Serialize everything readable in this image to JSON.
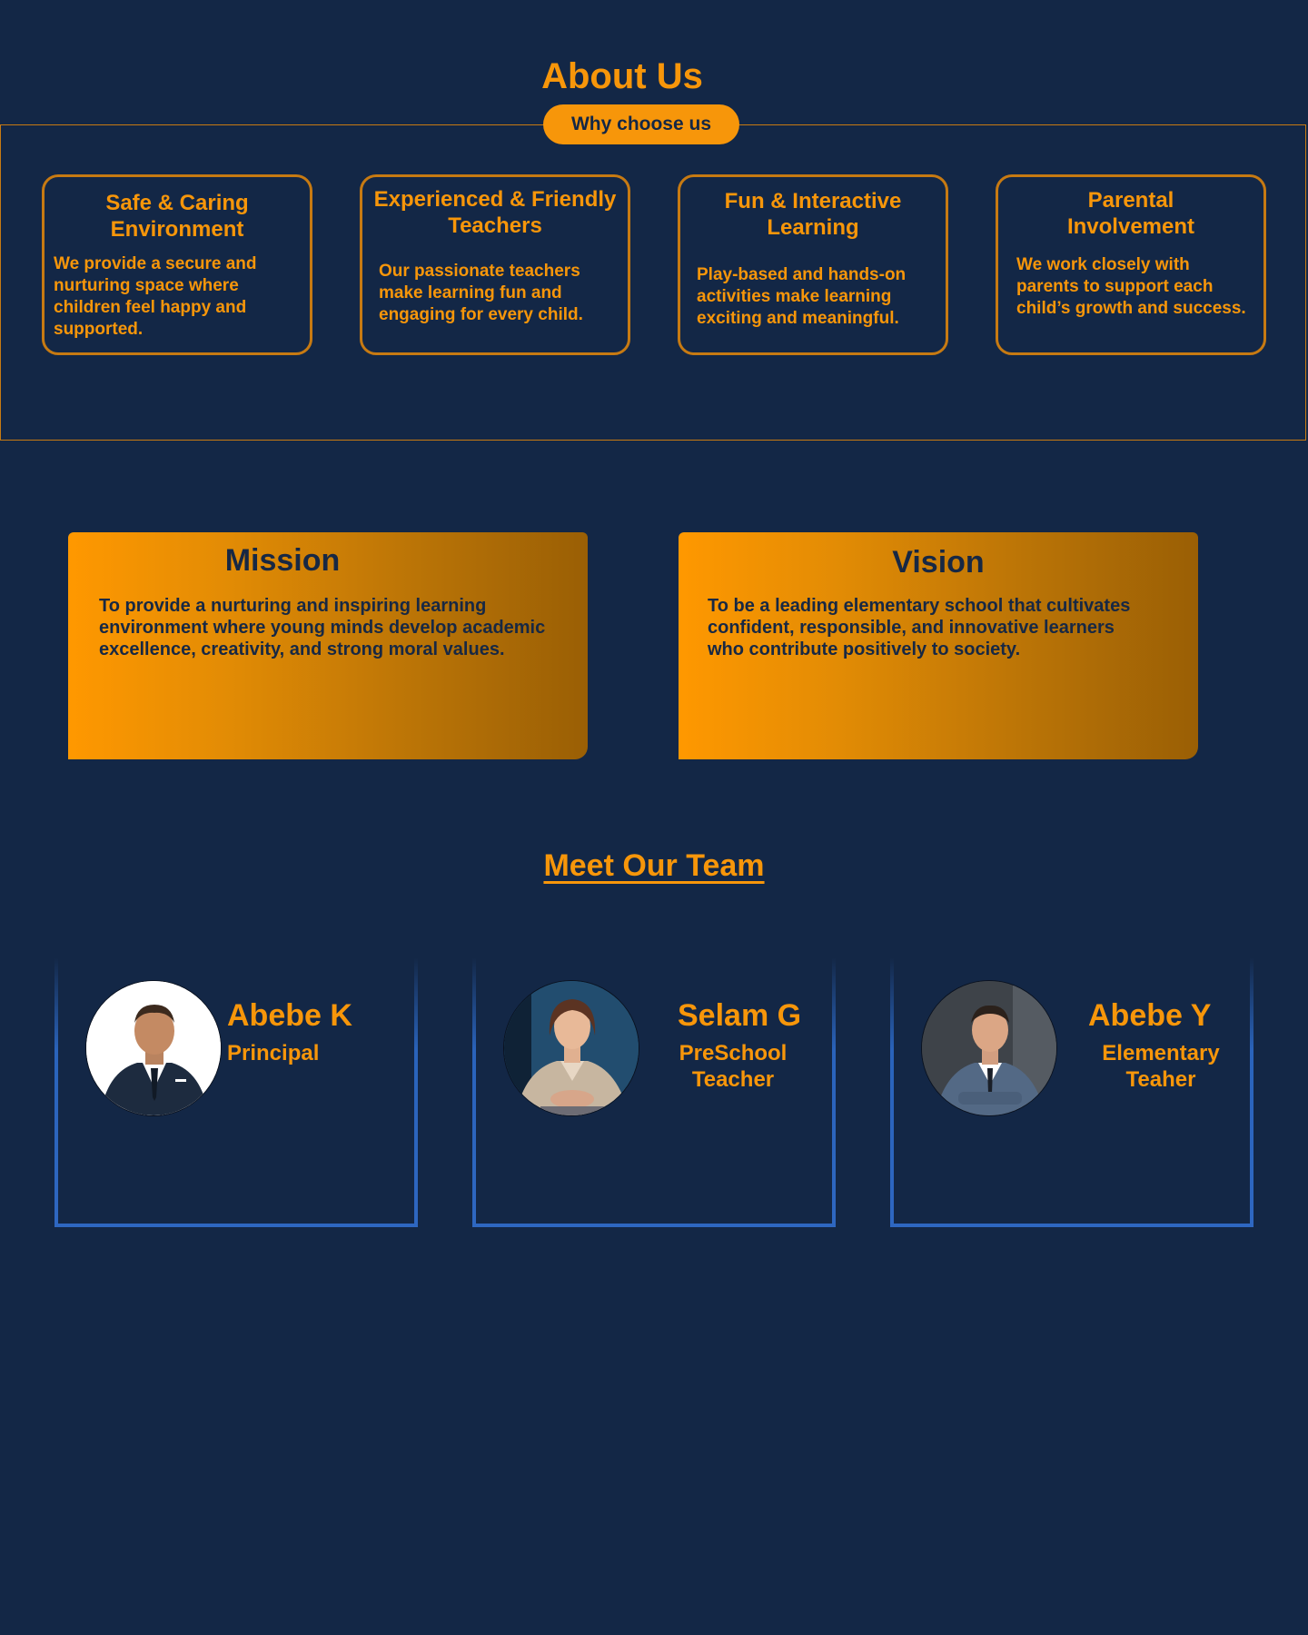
{
  "about": {
    "title": "About Us",
    "badge": "Why choose us",
    "features": [
      {
        "title": "Safe & Caring Environment",
        "body": "We provide a secure and nurturing space where children feel happy and supported."
      },
      {
        "title": "Experienced & Friendly Teachers",
        "body": "Our passionate teachers make learning fun and engaging for every child."
      },
      {
        "title": "Fun & Interactive Learning",
        "body": "Play-based and hands-on activities make learning exciting and meaningful."
      },
      {
        "title": "Parental Involvement",
        "body": "We work closely with parents to support each child’s growth and success."
      }
    ]
  },
  "mission": {
    "title": "Mission",
    "text": "To provide a nurturing and inspiring learning environment where young minds develop academic excellence, creativity, and strong moral values."
  },
  "vision": {
    "title": "Vision",
    "text": "To be a leading elementary school that cultivates confident, responsible, and innovative learners who contribute positively to society."
  },
  "team": {
    "title": "Meet Our Team",
    "members": [
      {
        "name": "Abebe K",
        "role": "Principal"
      },
      {
        "name": "Selam G",
        "role": "PreSchool Teacher"
      },
      {
        "name": "Abebe Y",
        "role": "Elementary Teaher"
      }
    ]
  },
  "colors": {
    "background": "#132746",
    "accent": "#f7960a",
    "team_border": "#2a63bb"
  }
}
